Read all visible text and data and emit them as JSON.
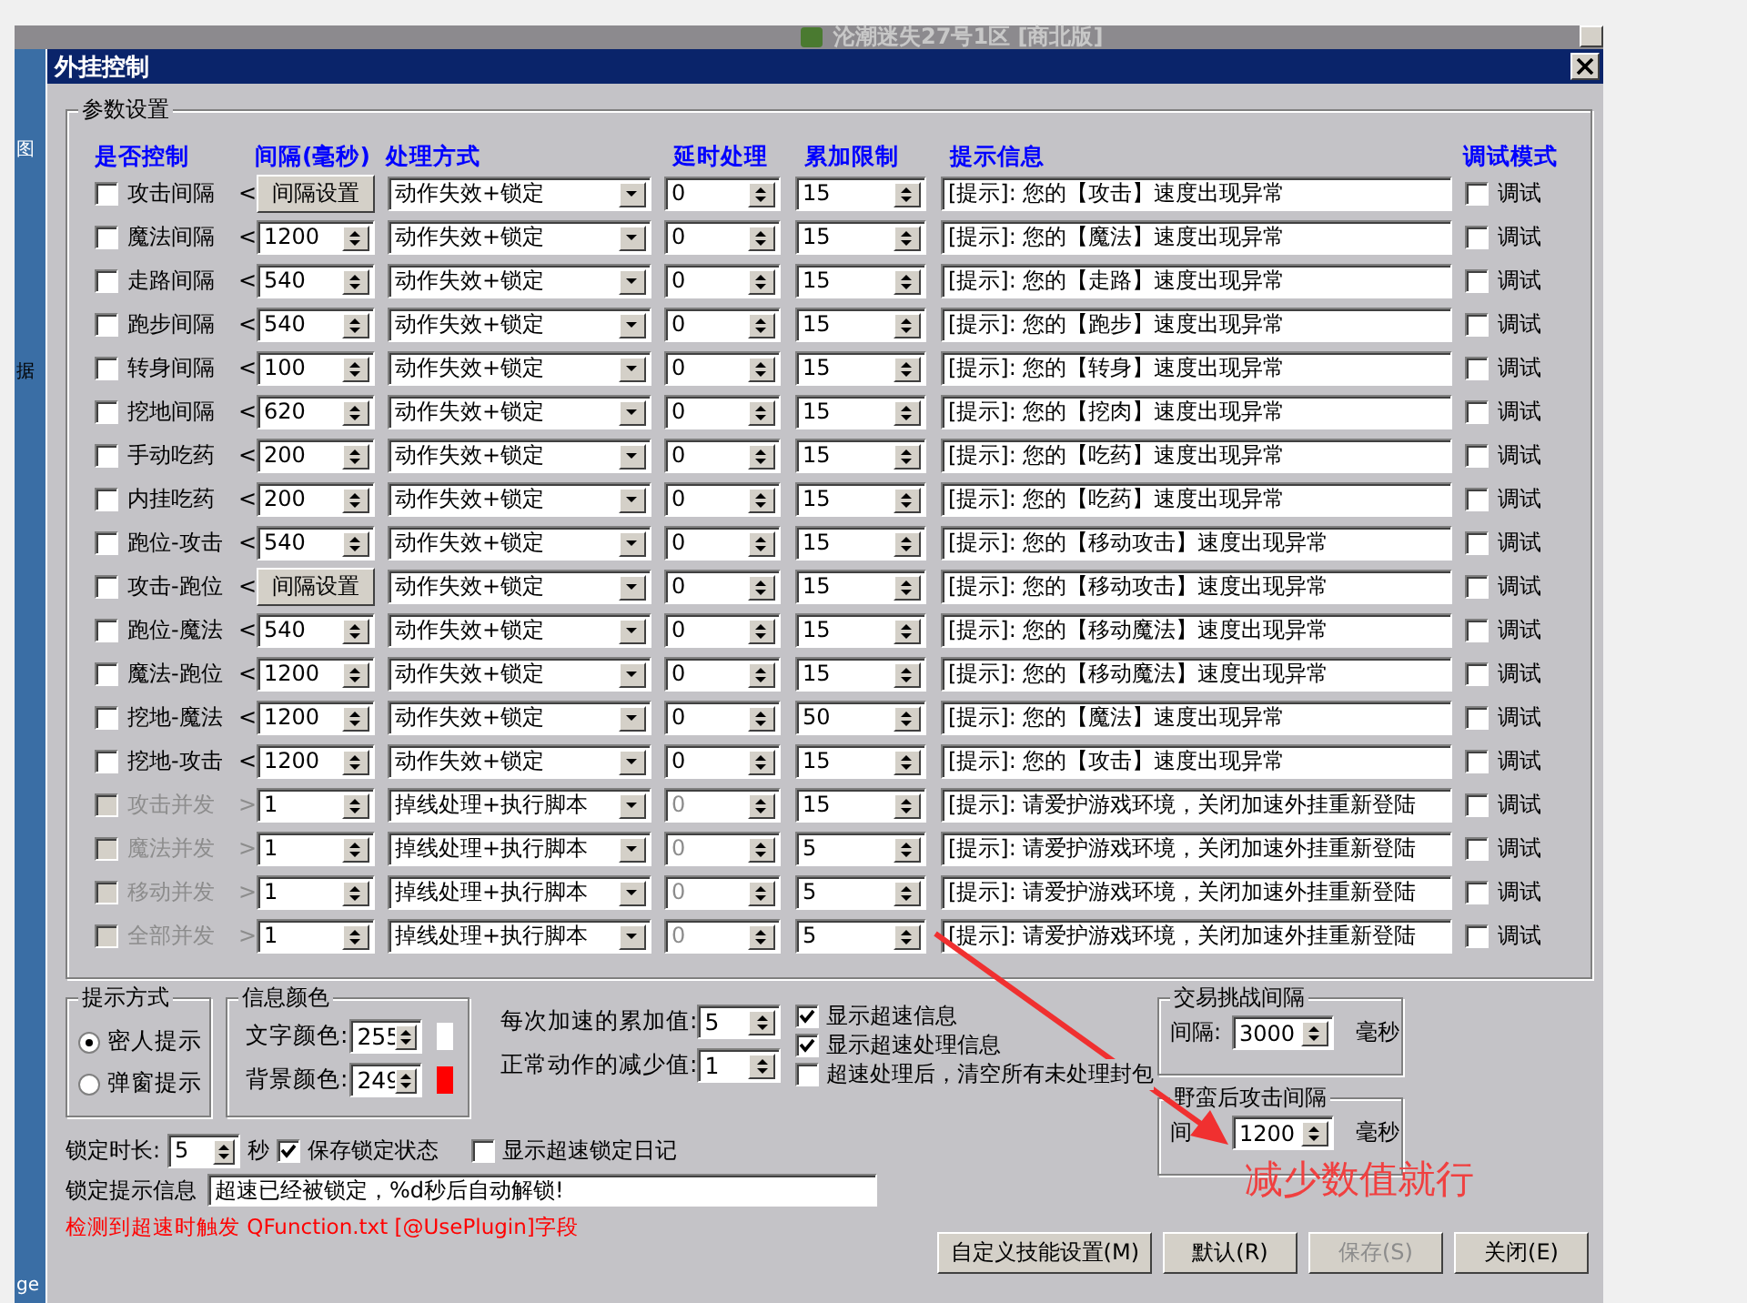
{
  "background_window": {
    "title": "沦潮迷失27号1区 [商北版]",
    "side_texts": [
      "图",
      "据",
      "ge"
    ]
  },
  "dialog": {
    "title": "外挂控制"
  },
  "params": {
    "legend": "参数设置",
    "headers": [
      "是否控制",
      "间隔(毫秒)",
      "处理方式",
      "延时处理",
      "累加限制",
      "提示信息",
      "调试模式"
    ],
    "rows": [
      {
        "label": "攻击间隔",
        "arrow": "<",
        "checked": false,
        "disabled": false,
        "interval": {
          "kind": "button",
          "text": "间隔设置"
        },
        "mode": "动作失效+锁定",
        "delay": "0",
        "limit": "15",
        "hint": "[提示]: 您的【攻击】速度出现异常",
        "debug_label": "调试",
        "debug": false
      },
      {
        "label": "魔法间隔",
        "arrow": "<",
        "checked": false,
        "disabled": false,
        "interval": {
          "kind": "spin",
          "text": "1200"
        },
        "mode": "动作失效+锁定",
        "delay": "0",
        "limit": "15",
        "hint": "[提示]: 您的【魔法】速度出现异常",
        "debug_label": "调试",
        "debug": false
      },
      {
        "label": "走路间隔",
        "arrow": "<",
        "checked": false,
        "disabled": false,
        "interval": {
          "kind": "spin",
          "text": "540"
        },
        "mode": "动作失效+锁定",
        "delay": "0",
        "limit": "15",
        "hint": "[提示]: 您的【走路】速度出现异常",
        "debug_label": "调试",
        "debug": false
      },
      {
        "label": "跑步间隔",
        "arrow": "<",
        "checked": false,
        "disabled": false,
        "interval": {
          "kind": "spin",
          "text": "540"
        },
        "mode": "动作失效+锁定",
        "delay": "0",
        "limit": "15",
        "hint": "[提示]: 您的【跑步】速度出现异常",
        "debug_label": "调试",
        "debug": false
      },
      {
        "label": "转身间隔",
        "arrow": "<",
        "checked": false,
        "disabled": false,
        "interval": {
          "kind": "spin",
          "text": "100"
        },
        "mode": "动作失效+锁定",
        "delay": "0",
        "limit": "15",
        "hint": "[提示]: 您的【转身】速度出现异常",
        "debug_label": "调试",
        "debug": false
      },
      {
        "label": "挖地间隔",
        "arrow": "<",
        "checked": false,
        "disabled": false,
        "interval": {
          "kind": "spin",
          "text": "620"
        },
        "mode": "动作失效+锁定",
        "delay": "0",
        "limit": "15",
        "hint": "[提示]: 您的【挖肉】速度出现异常",
        "debug_label": "调试",
        "debug": false
      },
      {
        "label": "手动吃药",
        "arrow": "<",
        "checked": false,
        "disabled": false,
        "interval": {
          "kind": "spin",
          "text": "200"
        },
        "mode": "动作失效+锁定",
        "delay": "0",
        "limit": "15",
        "hint": "[提示]: 您的【吃药】速度出现异常",
        "debug_label": "调试",
        "debug": false
      },
      {
        "label": "内挂吃药",
        "arrow": "<",
        "checked": false,
        "disabled": false,
        "interval": {
          "kind": "spin",
          "text": "200"
        },
        "mode": "动作失效+锁定",
        "delay": "0",
        "limit": "15",
        "hint": "[提示]: 您的【吃药】速度出现异常",
        "debug_label": "调试",
        "debug": false
      },
      {
        "label": "跑位-攻击",
        "arrow": "<",
        "checked": false,
        "disabled": false,
        "interval": {
          "kind": "spin",
          "text": "540"
        },
        "mode": "动作失效+锁定",
        "delay": "0",
        "limit": "15",
        "hint": "[提示]: 您的【移动攻击】速度出现异常",
        "debug_label": "调试",
        "debug": false
      },
      {
        "label": "攻击-跑位",
        "arrow": "<",
        "checked": false,
        "disabled": false,
        "interval": {
          "kind": "button",
          "text": "间隔设置"
        },
        "mode": "动作失效+锁定",
        "delay": "0",
        "limit": "15",
        "hint": "[提示]: 您的【移动攻击】速度出现异常",
        "debug_label": "调试",
        "debug": false
      },
      {
        "label": "跑位-魔法",
        "arrow": "<",
        "checked": false,
        "disabled": false,
        "interval": {
          "kind": "spin",
          "text": "540"
        },
        "mode": "动作失效+锁定",
        "delay": "0",
        "limit": "15",
        "hint": "[提示]: 您的【移动魔法】速度出现异常",
        "debug_label": "调试",
        "debug": false
      },
      {
        "label": "魔法-跑位",
        "arrow": "<",
        "checked": false,
        "disabled": false,
        "interval": {
          "kind": "spin",
          "text": "1200"
        },
        "mode": "动作失效+锁定",
        "delay": "0",
        "limit": "15",
        "hint": "[提示]: 您的【移动魔法】速度出现异常",
        "debug_label": "调试",
        "debug": false
      },
      {
        "label": "挖地-魔法",
        "arrow": "<",
        "checked": false,
        "disabled": false,
        "interval": {
          "kind": "spin",
          "text": "1200"
        },
        "mode": "动作失效+锁定",
        "delay": "0",
        "limit": "50",
        "hint": "[提示]: 您的【魔法】速度出现异常",
        "debug_label": "调试",
        "debug": false
      },
      {
        "label": "挖地-攻击",
        "arrow": "<",
        "checked": false,
        "disabled": false,
        "interval": {
          "kind": "spin",
          "text": "1200"
        },
        "mode": "动作失效+锁定",
        "delay": "0",
        "limit": "15",
        "hint": "[提示]: 您的【攻击】速度出现异常",
        "debug_label": "调试",
        "debug": false
      },
      {
        "label": "攻击并发",
        "arrow": ">",
        "checked": false,
        "disabled": true,
        "interval": {
          "kind": "spin",
          "text": "1"
        },
        "mode": "掉线处理+执行脚本",
        "delay": "0",
        "limit": "15",
        "hint": "[提示]: 请爱护游戏环境，关闭加速外挂重新登陆",
        "debug_label": "调试",
        "debug": false
      },
      {
        "label": "魔法并发",
        "arrow": ">",
        "checked": false,
        "disabled": true,
        "interval": {
          "kind": "spin",
          "text": "1"
        },
        "mode": "掉线处理+执行脚本",
        "delay": "0",
        "limit": "5",
        "hint": "[提示]: 请爱护游戏环境，关闭加速外挂重新登陆",
        "debug_label": "调试",
        "debug": false
      },
      {
        "label": "移动并发",
        "arrow": ">",
        "checked": false,
        "disabled": true,
        "interval": {
          "kind": "spin",
          "text": "1"
        },
        "mode": "掉线处理+执行脚本",
        "delay": "0",
        "limit": "5",
        "hint": "[提示]: 请爱护游戏环境，关闭加速外挂重新登陆",
        "debug_label": "调试",
        "debug": false
      },
      {
        "label": "全部并发",
        "arrow": ">",
        "checked": false,
        "disabled": true,
        "interval": {
          "kind": "spin",
          "text": "1"
        },
        "mode": "掉线处理+执行脚本",
        "delay": "0",
        "limit": "5",
        "hint": "[提示]: 请爱护游戏环境，关闭加速外挂重新登陆",
        "debug_label": "调试",
        "debug": false
      }
    ]
  },
  "hint_mode": {
    "legend": "提示方式",
    "options": [
      {
        "label": "密人提示",
        "selected": true
      },
      {
        "label": "弹窗提示",
        "selected": false
      }
    ]
  },
  "info_color": {
    "legend": "信息颜色",
    "items": [
      {
        "label": "文字颜色:",
        "value": "255",
        "color": "#ffffff"
      },
      {
        "label": "背景颜色:",
        "value": "249",
        "color": "#ff0000"
      }
    ]
  },
  "accumulate": [
    {
      "label": "每次加速的累加值:",
      "value": "5"
    },
    {
      "label": "正常动作的减少值:",
      "value": "1"
    }
  ],
  "options": [
    {
      "label": "显示超速信息",
      "checked": true
    },
    {
      "label": "显示超速处理信息",
      "checked": true
    },
    {
      "label": "超速处理后，清空所有未处理封包",
      "checked": false
    }
  ],
  "trade_interval": {
    "legend": "交易挑战间隔",
    "label": "间隔:",
    "value": "3000",
    "unit": "毫秒"
  },
  "savage_interval": {
    "legend": "野蛮后攻击间隔",
    "label": "间",
    "value": "1200",
    "unit": "毫秒"
  },
  "lock": {
    "label": "锁定时长:",
    "value": "5",
    "unit": "秒",
    "save_label": "保存锁定状态",
    "save_checked": true,
    "log_label": "显示超速锁定日记",
    "log_checked": false
  },
  "lock_message": {
    "label": "锁定提示信息",
    "value": "超速已经被锁定，%d秒后自动解锁!"
  },
  "trigger_note": "检测到超速时触发 QFunction.txt [@UsePlugin]字段",
  "buttons": [
    {
      "label": "自定义技能设置(M)",
      "disabled": false
    },
    {
      "label": "默认(R)",
      "disabled": false
    },
    {
      "label": "保存(S)",
      "disabled": true
    },
    {
      "label": "关闭(E)",
      "disabled": false
    }
  ],
  "annotation": "减少数值就行"
}
